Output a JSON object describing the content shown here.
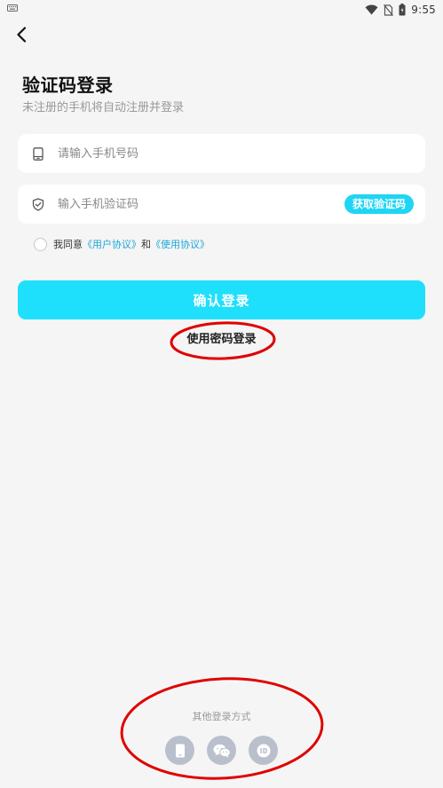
{
  "status_bar": {
    "time": "9:55"
  },
  "header": {
    "title": "验证码登录",
    "subtitle": "未注册的手机将自动注册并登录"
  },
  "form": {
    "phone_placeholder": "请输入手机号码",
    "code_placeholder": "输入手机验证码",
    "get_code_label": "获取验证码"
  },
  "agreement": {
    "prefix": "我同意",
    "user_agreement": "《用户协议》",
    "and": "和",
    "usage_agreement": "《使用协议》"
  },
  "actions": {
    "confirm_label": "确认登录",
    "password_login_label": "使用密码登录"
  },
  "other_login": {
    "title": "其他登录方式",
    "options": [
      {
        "icon": "phone-icon"
      },
      {
        "icon": "wechat-icon"
      },
      {
        "icon": "id-icon"
      }
    ]
  },
  "colors": {
    "accent": "#1fe0fc",
    "link": "#1aa7d8",
    "annotation": "#e00000"
  }
}
